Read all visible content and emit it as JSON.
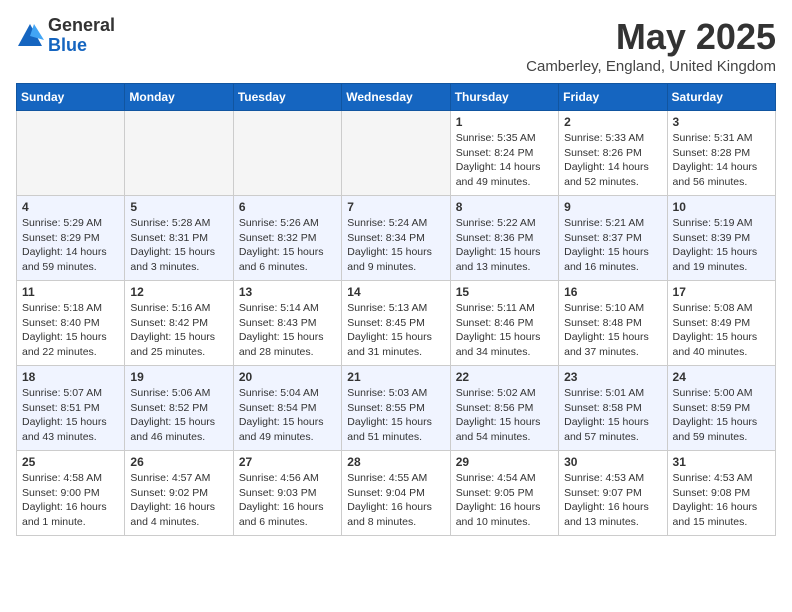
{
  "logo": {
    "general": "General",
    "blue": "Blue"
  },
  "title": "May 2025",
  "location": "Camberley, England, United Kingdom",
  "headers": [
    "Sunday",
    "Monday",
    "Tuesday",
    "Wednesday",
    "Thursday",
    "Friday",
    "Saturday"
  ],
  "weeks": [
    [
      {
        "day": "",
        "info": ""
      },
      {
        "day": "",
        "info": ""
      },
      {
        "day": "",
        "info": ""
      },
      {
        "day": "",
        "info": ""
      },
      {
        "day": "1",
        "info": "Sunrise: 5:35 AM\nSunset: 8:24 PM\nDaylight: 14 hours\nand 49 minutes."
      },
      {
        "day": "2",
        "info": "Sunrise: 5:33 AM\nSunset: 8:26 PM\nDaylight: 14 hours\nand 52 minutes."
      },
      {
        "day": "3",
        "info": "Sunrise: 5:31 AM\nSunset: 8:28 PM\nDaylight: 14 hours\nand 56 minutes."
      }
    ],
    [
      {
        "day": "4",
        "info": "Sunrise: 5:29 AM\nSunset: 8:29 PM\nDaylight: 14 hours\nand 59 minutes."
      },
      {
        "day": "5",
        "info": "Sunrise: 5:28 AM\nSunset: 8:31 PM\nDaylight: 15 hours\nand 3 minutes."
      },
      {
        "day": "6",
        "info": "Sunrise: 5:26 AM\nSunset: 8:32 PM\nDaylight: 15 hours\nand 6 minutes."
      },
      {
        "day": "7",
        "info": "Sunrise: 5:24 AM\nSunset: 8:34 PM\nDaylight: 15 hours\nand 9 minutes."
      },
      {
        "day": "8",
        "info": "Sunrise: 5:22 AM\nSunset: 8:36 PM\nDaylight: 15 hours\nand 13 minutes."
      },
      {
        "day": "9",
        "info": "Sunrise: 5:21 AM\nSunset: 8:37 PM\nDaylight: 15 hours\nand 16 minutes."
      },
      {
        "day": "10",
        "info": "Sunrise: 5:19 AM\nSunset: 8:39 PM\nDaylight: 15 hours\nand 19 minutes."
      }
    ],
    [
      {
        "day": "11",
        "info": "Sunrise: 5:18 AM\nSunset: 8:40 PM\nDaylight: 15 hours\nand 22 minutes."
      },
      {
        "day": "12",
        "info": "Sunrise: 5:16 AM\nSunset: 8:42 PM\nDaylight: 15 hours\nand 25 minutes."
      },
      {
        "day": "13",
        "info": "Sunrise: 5:14 AM\nSunset: 8:43 PM\nDaylight: 15 hours\nand 28 minutes."
      },
      {
        "day": "14",
        "info": "Sunrise: 5:13 AM\nSunset: 8:45 PM\nDaylight: 15 hours\nand 31 minutes."
      },
      {
        "day": "15",
        "info": "Sunrise: 5:11 AM\nSunset: 8:46 PM\nDaylight: 15 hours\nand 34 minutes."
      },
      {
        "day": "16",
        "info": "Sunrise: 5:10 AM\nSunset: 8:48 PM\nDaylight: 15 hours\nand 37 minutes."
      },
      {
        "day": "17",
        "info": "Sunrise: 5:08 AM\nSunset: 8:49 PM\nDaylight: 15 hours\nand 40 minutes."
      }
    ],
    [
      {
        "day": "18",
        "info": "Sunrise: 5:07 AM\nSunset: 8:51 PM\nDaylight: 15 hours\nand 43 minutes."
      },
      {
        "day": "19",
        "info": "Sunrise: 5:06 AM\nSunset: 8:52 PM\nDaylight: 15 hours\nand 46 minutes."
      },
      {
        "day": "20",
        "info": "Sunrise: 5:04 AM\nSunset: 8:54 PM\nDaylight: 15 hours\nand 49 minutes."
      },
      {
        "day": "21",
        "info": "Sunrise: 5:03 AM\nSunset: 8:55 PM\nDaylight: 15 hours\nand 51 minutes."
      },
      {
        "day": "22",
        "info": "Sunrise: 5:02 AM\nSunset: 8:56 PM\nDaylight: 15 hours\nand 54 minutes."
      },
      {
        "day": "23",
        "info": "Sunrise: 5:01 AM\nSunset: 8:58 PM\nDaylight: 15 hours\nand 57 minutes."
      },
      {
        "day": "24",
        "info": "Sunrise: 5:00 AM\nSunset: 8:59 PM\nDaylight: 15 hours\nand 59 minutes."
      }
    ],
    [
      {
        "day": "25",
        "info": "Sunrise: 4:58 AM\nSunset: 9:00 PM\nDaylight: 16 hours\nand 1 minute."
      },
      {
        "day": "26",
        "info": "Sunrise: 4:57 AM\nSunset: 9:02 PM\nDaylight: 16 hours\nand 4 minutes."
      },
      {
        "day": "27",
        "info": "Sunrise: 4:56 AM\nSunset: 9:03 PM\nDaylight: 16 hours\nand 6 minutes."
      },
      {
        "day": "28",
        "info": "Sunrise: 4:55 AM\nSunset: 9:04 PM\nDaylight: 16 hours\nand 8 minutes."
      },
      {
        "day": "29",
        "info": "Sunrise: 4:54 AM\nSunset: 9:05 PM\nDaylight: 16 hours\nand 10 minutes."
      },
      {
        "day": "30",
        "info": "Sunrise: 4:53 AM\nSunset: 9:07 PM\nDaylight: 16 hours\nand 13 minutes."
      },
      {
        "day": "31",
        "info": "Sunrise: 4:53 AM\nSunset: 9:08 PM\nDaylight: 16 hours\nand 15 minutes."
      }
    ]
  ]
}
